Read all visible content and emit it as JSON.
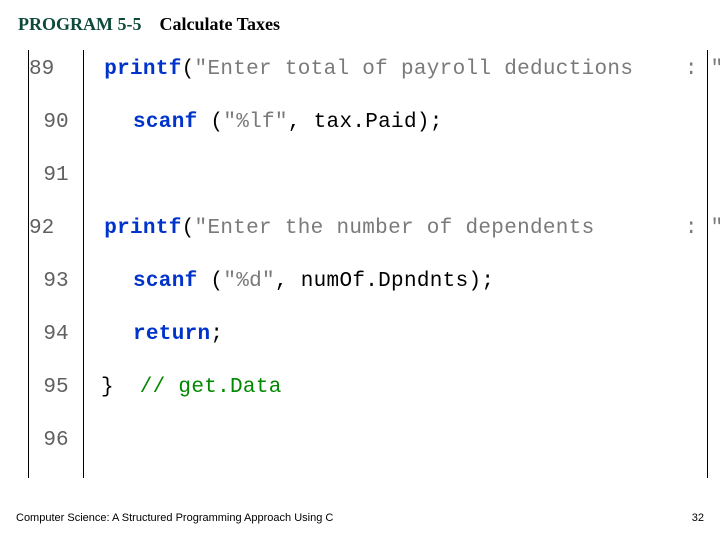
{
  "header": {
    "program_label": "PROGRAM 5-5",
    "program_title": "Calculate Taxes"
  },
  "code": {
    "lines": [
      {
        "num": "89",
        "indent": 1,
        "tokens": [
          {
            "t": "printf",
            "c": "kw"
          },
          {
            "t": "(",
            "c": ""
          },
          {
            "t": "\"Enter total of payroll deductions    : \"",
            "c": "str"
          },
          {
            "t": ");",
            "c": ""
          }
        ]
      },
      {
        "num": "90",
        "indent": 1,
        "tokens": [
          {
            "t": "scanf ",
            "c": "kw"
          },
          {
            "t": "(",
            "c": ""
          },
          {
            "t": "\"%lf\"",
            "c": "str"
          },
          {
            "t": ", tax.Paid);",
            "c": ""
          }
        ]
      },
      {
        "num": "91",
        "indent": 0,
        "tokens": []
      },
      {
        "num": "92",
        "indent": 1,
        "tokens": [
          {
            "t": "printf",
            "c": "kw"
          },
          {
            "t": "(",
            "c": ""
          },
          {
            "t": "\"Enter the number of dependents       : \"",
            "c": "str"
          },
          {
            "t": ");",
            "c": ""
          }
        ]
      },
      {
        "num": "93",
        "indent": 1,
        "tokens": [
          {
            "t": "scanf ",
            "c": "kw"
          },
          {
            "t": "(",
            "c": ""
          },
          {
            "t": "\"%d\"",
            "c": "str"
          },
          {
            "t": ", numOf.Dpndnts);",
            "c": ""
          }
        ]
      },
      {
        "num": "94",
        "indent": 1,
        "tokens": [
          {
            "t": "return",
            "c": "kw"
          },
          {
            "t": ";",
            "c": ""
          }
        ]
      },
      {
        "num": "95",
        "indent": 0,
        "tokens": [
          {
            "t": "}",
            "c": "brace"
          },
          {
            "t": "  ",
            "c": ""
          },
          {
            "t": "// get.Data",
            "c": "comment"
          }
        ]
      },
      {
        "num": "96",
        "indent": 0,
        "tokens": []
      }
    ]
  },
  "footer": {
    "book": "Computer Science: A Structured Programming Approach Using C",
    "page": "32"
  }
}
